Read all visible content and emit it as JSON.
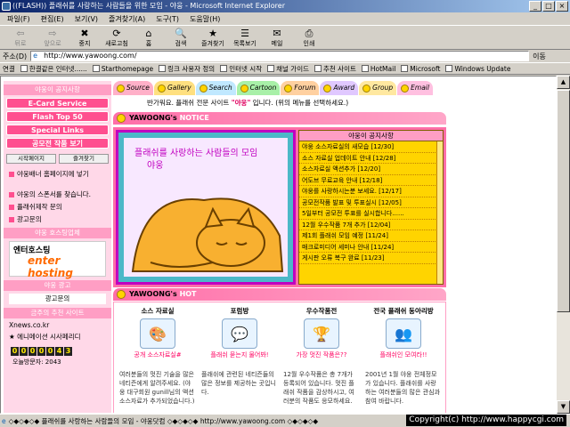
{
  "window": {
    "title": "((FLASH)) 플래쉬를 사랑하는 사람들을 위한 모임 - 야웅 - Microsoft Internet Explorer",
    "btn_min": "_",
    "btn_max": "□",
    "btn_close": "×"
  },
  "menu": [
    "파일(F)",
    "편집(E)",
    "보기(V)",
    "즐겨찾기(A)",
    "도구(T)",
    "도움말(H)"
  ],
  "toolbar": [
    {
      "label": "뒤로",
      "icon": "back-arrow-icon",
      "disabled": true
    },
    {
      "label": "앞으로",
      "icon": "forward-arrow-icon",
      "disabled": true
    },
    {
      "label": "중지",
      "icon": "stop-icon",
      "disabled": false
    },
    {
      "label": "새로고침",
      "icon": "refresh-icon",
      "disabled": false
    },
    {
      "label": "홈",
      "icon": "home-icon",
      "disabled": false
    },
    {
      "label": "검색",
      "icon": "search-icon",
      "disabled": false
    },
    {
      "label": "즐겨찾기",
      "icon": "favorites-icon",
      "disabled": false
    },
    {
      "label": "목록보기",
      "icon": "history-icon",
      "disabled": false
    },
    {
      "label": "메일",
      "icon": "mail-icon",
      "disabled": false
    },
    {
      "label": "인쇄",
      "icon": "print-icon",
      "disabled": false
    }
  ],
  "address": {
    "label": "주소(D)",
    "url": "http://www.yawoong.com/",
    "go": "이동"
  },
  "links": {
    "label": "연결",
    "items": [
      "한결같은 인터넷......",
      "Starthomepage",
      "링크 사용자 정의",
      "인터넷 시작",
      "채널 가이드",
      "추천 사이트",
      "HotMail",
      "Microsoft",
      "Windows Update"
    ]
  },
  "left": {
    "notice_title": "야웅이 공지사항",
    "buttons": [
      "E-Card Service",
      "Flash Top 50",
      "Special Links",
      "공모전 작품 보기"
    ],
    "small_buttons": [
      "시작페이지",
      "즐겨찾기"
    ],
    "rows1": [
      "야웅배너 홈페이지에 넣기"
    ],
    "rows2": [
      "야웅의 스폰서를 찾습니다.",
      "플래쉬제작 문의",
      "광고문의"
    ],
    "hosting_title": "야웅 호스팅업체",
    "hosting_name": "엔터호스팅",
    "hosting_logo": "enter hosting",
    "ad_title": "야웅 광고",
    "ad_text": "광고문의",
    "recommend_title": "금주의 추천 사이트",
    "recommend": [
      "Xnews.co.kr",
      "★ 에니메이션 시사페리디"
    ],
    "counter_digits": [
      "0",
      "0",
      "0",
      "0",
      "0",
      "4",
      "3"
    ],
    "visitors": "오늘방문자: 2043"
  },
  "tabs": [
    {
      "label": "Source",
      "color": "#ffb0c8"
    },
    {
      "label": "Gallery",
      "color": "#ffe080"
    },
    {
      "label": "Search",
      "color": "#c0e8ff"
    },
    {
      "label": "Cartoon",
      "color": "#a8f0a8"
    },
    {
      "label": "Forum",
      "color": "#ffd0a0"
    },
    {
      "label": "Award",
      "color": "#e0c8ff"
    },
    {
      "label": "Group",
      "color": "#ffe8a0"
    },
    {
      "label": "Email",
      "color": "#ffc0e0"
    }
  ],
  "welcome": {
    "pre": "반가워요. 플래쉬 전문 사이트 ",
    "site": "\"야웅\"",
    "post": " 입니다. (위의 메뉴를 선택하세요.)"
  },
  "notice": {
    "header_main": "YAWOONG's",
    "header_sub": "NOTICE",
    "art_title": "플래쉬를 사랑하는 사람들의 모임",
    "art_sub": "야웅",
    "box_title": "야웅이 공지사항",
    "items": [
      "야웅 소스자료실의 새모습 [12/30]",
      "소스 자료실 업데이트 안내 [12/28]",
      "소스자료실 액션추가 [12/20]",
      "어도브 무료교육 안내 [12/18]",
      "야웅를 사랑하시는분 보세요. [12/17]",
      "공모전작품 발표 및 투표실시 [12/05]",
      "5일부터 공모전 투표를 실시합니다......",
      "12월 우수작품 7개 추가 [12/04]",
      "제1회 플래쉬 모임 예정 [11/24]",
      "매크로미디어 세미나 안내 [11/24]",
      "게시판 오류 복구 완료 [11/23]"
    ]
  },
  "hot": {
    "header_main": "YAWOONG's",
    "header_sub": "HOT",
    "cols": [
      {
        "title": "소스 자료실",
        "link": "공개 소스자료실#",
        "desc": "여러분들의 멋진 기술을 많은 네티즌에게 알려주세요. (야웅 대구회원 gunill님의 액션 소스자료가 추가되었습니다.)",
        "icon": "🎨"
      },
      {
        "title": "포럼방",
        "link": "플래쉬 묻는지 물어봐!",
        "desc": "플래쉬에 관련된 네티즌들의 많은 정보를 제공하는 곳입니다.",
        "icon": "💬"
      },
      {
        "title": "우수작품전",
        "link": "가장 멋진 작품은??",
        "desc": "12월 우수작품은 총 7개가 등록되어 있습니다. 멋진 플래쉬 작품을 감상하시고, 여러분의 작품도 응모하세요.",
        "icon": "🏆"
      },
      {
        "title": "전국 플래쉬 동아리방",
        "link": "플래쉬인 모여라!!",
        "desc": "2001년 1월 야웅 전체정모가 있습니다. 플래쉬를 사랑하는 여러분들의 많은 관심과 참여 바랍니다.",
        "icon": "👥"
      }
    ]
  },
  "status": "◇◆◇◆◇◆ 플래쉬를 사랑하는 사람들의 모임 - 야웅닷컴 ◇◆◇◆◇◆ http://www.yawoong.com ◇◆◇◆◇◆",
  "copyright": "Copyright(c) http://www.happycgi.com"
}
